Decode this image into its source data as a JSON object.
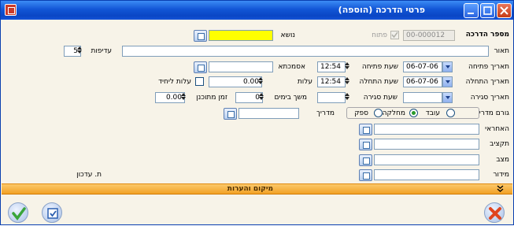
{
  "window": {
    "title": "פרטי הדרכה (הוספה)"
  },
  "form": {
    "training_number_label": "מספר הדרכה",
    "training_number_value": "00-000012",
    "open_label": "פתוח",
    "subject_label": "נושא",
    "subject_value": "",
    "description_label": "תאור",
    "description_value": "",
    "priority_label": "עדיפות",
    "priority_value": "5",
    "open_date_label": "תאריך פתיחה",
    "open_date_value": "06-07-06",
    "open_time_label": "שעת פתיחה",
    "open_time_value": "12:54",
    "reference_label": "אסמכתא",
    "reference_value": "",
    "start_date_label": "תאריך התחלה",
    "start_date_value": "06-07-06",
    "start_time_label": "שעת התחלה",
    "start_time_value": "12:54",
    "cost_label": "עלות",
    "cost_value": "0.00",
    "unit_cost_label": "עלות ליחיד",
    "close_date_label": "תאריך סגירה",
    "close_date_value": "",
    "close_time_label": "שעת סגירה",
    "close_time_value": "",
    "duration_label": "משך בימים",
    "duration_value": "0",
    "planned_time_label": "זמן מתוכנן",
    "planned_time_value": "0.00",
    "instructor_source_label": "גורם מדריך",
    "source_options": [
      "עובד",
      "מחלקה",
      "ספק"
    ],
    "source_selected": "מחלקה",
    "instructor_label": "מדריך",
    "instructor_value": "",
    "responsible_label": "האחראי",
    "budget_label": "תקציב",
    "status_label": "מצב",
    "measure_label": "מידור",
    "updated_label": "ת. עדכון"
  },
  "section_bar": {
    "label": "מיקום והערות"
  },
  "colors": {
    "title_bar": "#0a46c4",
    "window_bg": "#f7f3e8",
    "section_bar": "#f2a126",
    "subject_field": "#ffff00"
  },
  "icons": {
    "ok": "checkmark-icon",
    "edit": "edit-icon",
    "cancel": "x-icon",
    "expand": "double-chevron-down-icon"
  }
}
